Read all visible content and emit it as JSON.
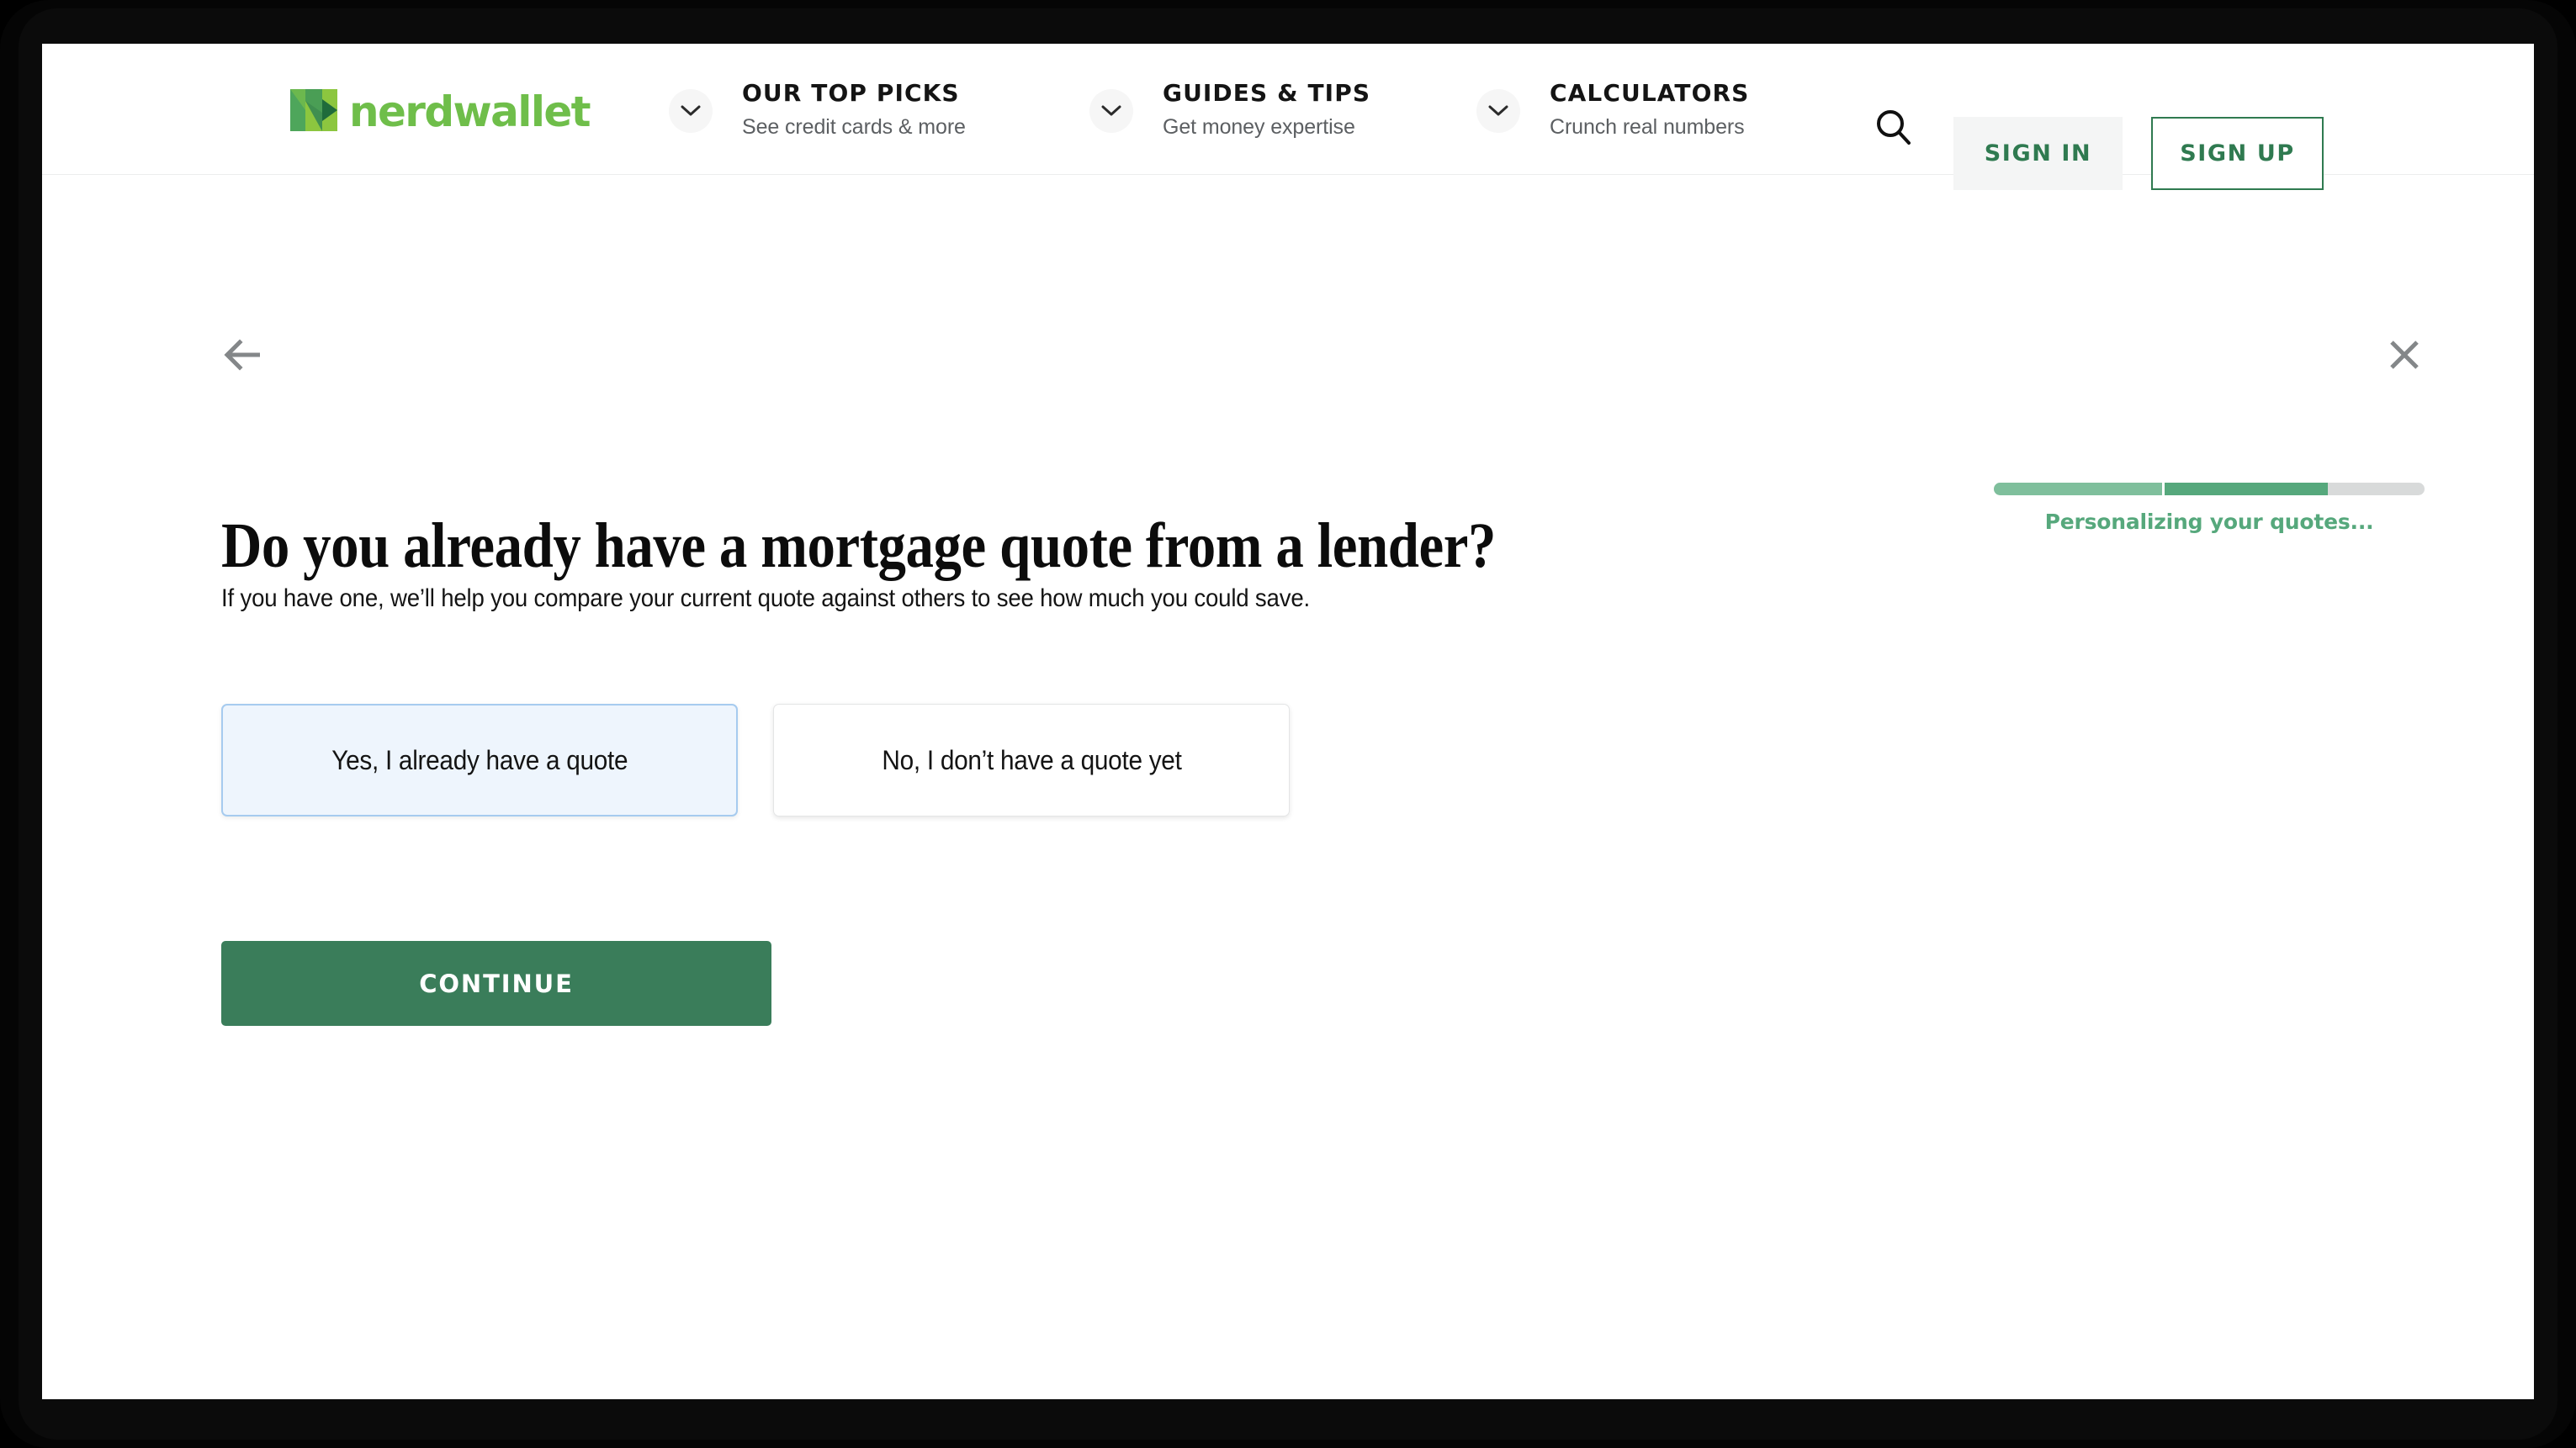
{
  "brand": {
    "name": "nerdwallet",
    "logo_colors": {
      "light_green": "#8cc63f",
      "mid_green": "#4ea65b",
      "dark_green": "#1f6b3b",
      "wordmark_green": "#6fbe4a"
    }
  },
  "header": {
    "nav": [
      {
        "title": "OUR TOP PICKS",
        "subtitle": "See credit cards & more"
      },
      {
        "title": "GUIDES & TIPS",
        "subtitle": "Get money expertise"
      },
      {
        "title": "CALCULATORS",
        "subtitle": "Crunch real numbers"
      }
    ],
    "search_icon": "search-icon",
    "sign_in_label": "SIGN IN",
    "sign_up_label": "SIGN UP",
    "accent_green": "#2f7a50"
  },
  "form": {
    "back_icon": "arrow-left-icon",
    "close_icon": "close-icon",
    "heading": "Do you already have a mortgage quote from a lender?",
    "subheading": "If you have one, we’ll help you compare your current quote against others to see how much you could save.",
    "options": [
      {
        "label": "Yes, I already have a quote",
        "selected": true
      },
      {
        "label": "No, I don’t have a quote yet",
        "selected": false
      }
    ],
    "continue_label": "CONTINUE",
    "continue_color": "#3a7d5a",
    "selected_bg": "#eef5fd",
    "selected_border": "#a6cbef"
  },
  "progress": {
    "label": "Personalizing your quotes...",
    "segments": [
      {
        "width_pct": 39,
        "color": "#7fbf9c"
      },
      {
        "width_pct": 38,
        "color": "#56a87c"
      }
    ],
    "remaining_pct": 23,
    "track_color": "#d8dada",
    "label_color": "#56a87c"
  }
}
